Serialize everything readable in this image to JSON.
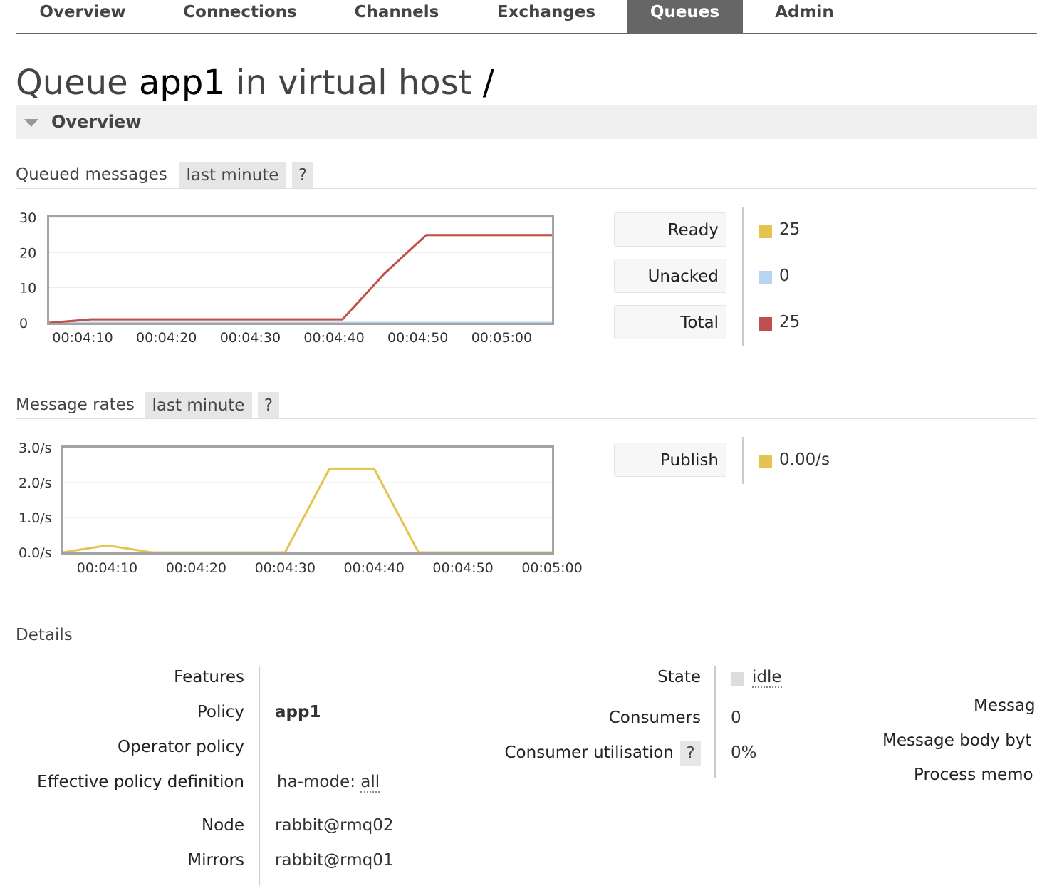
{
  "nav": {
    "tabs": [
      {
        "label": "Overview",
        "active": false
      },
      {
        "label": "Connections",
        "active": false
      },
      {
        "label": "Channels",
        "active": false
      },
      {
        "label": "Exchanges",
        "active": false
      },
      {
        "label": "Queues",
        "active": true
      },
      {
        "label": "Admin",
        "active": false
      }
    ]
  },
  "title": {
    "prefix": "Queue",
    "name": "app1",
    "middle": "in virtual host",
    "vhost": "/"
  },
  "overview_section": {
    "label": "Overview"
  },
  "queued_messages": {
    "heading": "Queued messages",
    "range_button": "last minute",
    "help_button": "?",
    "legend": [
      {
        "label": "Ready",
        "value": "25",
        "color": "#e4c34e"
      },
      {
        "label": "Unacked",
        "value": "0",
        "color": "#b7d5f1"
      },
      {
        "label": "Total",
        "value": "25",
        "color": "#c0504d"
      }
    ]
  },
  "message_rates": {
    "heading": "Message rates",
    "range_button": "last minute",
    "help_button": "?",
    "legend": [
      {
        "label": "Publish",
        "value": "0.00/s",
        "color": "#e4c34e"
      }
    ]
  },
  "chart_data": [
    {
      "type": "line",
      "title": "",
      "x": [
        "00:04:06",
        "00:04:11",
        "00:04:16",
        "00:04:21",
        "00:04:26",
        "00:04:31",
        "00:04:36",
        "00:04:41",
        "00:04:46",
        "00:04:51",
        "00:04:56",
        "00:05:01",
        "00:05:06"
      ],
      "x_ticks": [
        "00:04:10",
        "00:04:20",
        "00:04:30",
        "00:04:40",
        "00:04:50",
        "00:05:00"
      ],
      "y_ticks": [
        "0",
        "10",
        "20",
        "30"
      ],
      "ylim": [
        0,
        30
      ],
      "series": [
        {
          "name": "Ready",
          "color": "#e4c34e",
          "values": [
            0,
            1,
            1,
            1,
            1,
            1,
            1,
            1,
            14,
            25,
            25,
            25,
            25
          ]
        },
        {
          "name": "Unacked",
          "color": "#b7d5f1",
          "values": [
            0,
            0,
            0,
            0,
            0,
            0,
            0,
            0,
            0,
            0,
            0,
            0,
            0
          ]
        },
        {
          "name": "Total",
          "color": "#c0504d",
          "values": [
            0,
            1,
            1,
            1,
            1,
            1,
            1,
            1,
            14,
            25,
            25,
            25,
            25
          ]
        }
      ]
    },
    {
      "type": "line",
      "title": "",
      "x": [
        "00:04:05",
        "00:04:10",
        "00:04:15",
        "00:04:20",
        "00:04:25",
        "00:04:30",
        "00:04:35",
        "00:04:40",
        "00:04:45",
        "00:04:50",
        "00:04:55",
        "00:05:00"
      ],
      "x_ticks": [
        "00:04:10",
        "00:04:20",
        "00:04:30",
        "00:04:40",
        "00:04:50",
        "00:05:00"
      ],
      "y_ticks": [
        "0.0/s",
        "1.0/s",
        "2.0/s",
        "3.0/s"
      ],
      "ylim": [
        0,
        3
      ],
      "series": [
        {
          "name": "Publish",
          "color": "#e4c34e",
          "values": [
            0,
            0.2,
            0,
            0,
            0,
            0,
            2.4,
            2.4,
            0,
            0,
            0,
            0
          ]
        }
      ]
    }
  ],
  "details": {
    "heading": "Details",
    "left": [
      {
        "label": "Features",
        "value": ""
      },
      {
        "label": "Policy",
        "value": "app1"
      },
      {
        "label": "Operator policy",
        "value": ""
      },
      {
        "label": "Effective policy definition",
        "value_key": "ha-mode:",
        "value": "all"
      },
      {
        "label": "Node",
        "value": "rabbit@rmq02"
      },
      {
        "label": "Mirrors",
        "value": "rabbit@rmq01"
      }
    ],
    "middle": [
      {
        "label": "State",
        "value": "idle",
        "swatch_color": "#dddddd"
      },
      {
        "label": "Consumers",
        "value": "0"
      },
      {
        "label": "Consumer utilisation",
        "value": "0%",
        "help": "?"
      }
    ],
    "right": [
      {
        "label": "Messag"
      },
      {
        "label": "Message body byt"
      },
      {
        "label": "Process memo"
      }
    ]
  }
}
